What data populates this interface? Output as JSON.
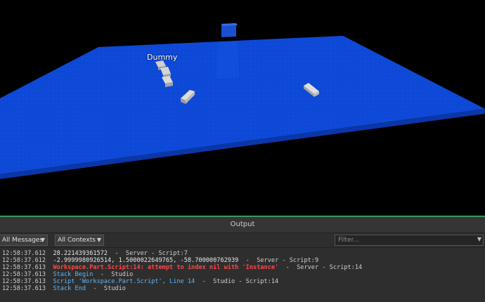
{
  "viewport": {
    "dummy_label": "Dummy",
    "colors": {
      "baseplate": "#0d49d6",
      "background": "#000000"
    }
  },
  "output": {
    "title": "Output",
    "messages_filter": "All Messages",
    "contexts_filter": "All Contexts",
    "filter_placeholder": "Filter...",
    "logs": [
      {
        "time": "12:58:37.612",
        "message": "28.221439361572",
        "source": "  -  Server - Script:7",
        "type": "normal"
      },
      {
        "time": "12:58:37.612",
        "message": "-2.9999980926514, 1.5000022649765, -58.700000762939",
        "source": "  -  Server - Script:9",
        "type": "normal"
      },
      {
        "time": "12:58:37.613",
        "message": "Workspace.Part.Script:14: attempt to index nil with 'Instance'",
        "source": "  -  Server - Script:14",
        "type": "error"
      },
      {
        "time": "12:58:37.613",
        "message": "Stack Begin",
        "source": "  -  Studio",
        "type": "info"
      },
      {
        "time": "12:58:37.613",
        "message": "Script 'Workspace.Part.Script', Line 14",
        "source": "  -  Studio - Script:14",
        "type": "info"
      },
      {
        "time": "12:58:37.613",
        "message": "Stack End",
        "source": "  -  Studio",
        "type": "info"
      }
    ],
    "colors": {
      "error": "#ff4747",
      "info": "#5fb5f7",
      "accent_border": "#3a9a5c"
    }
  }
}
